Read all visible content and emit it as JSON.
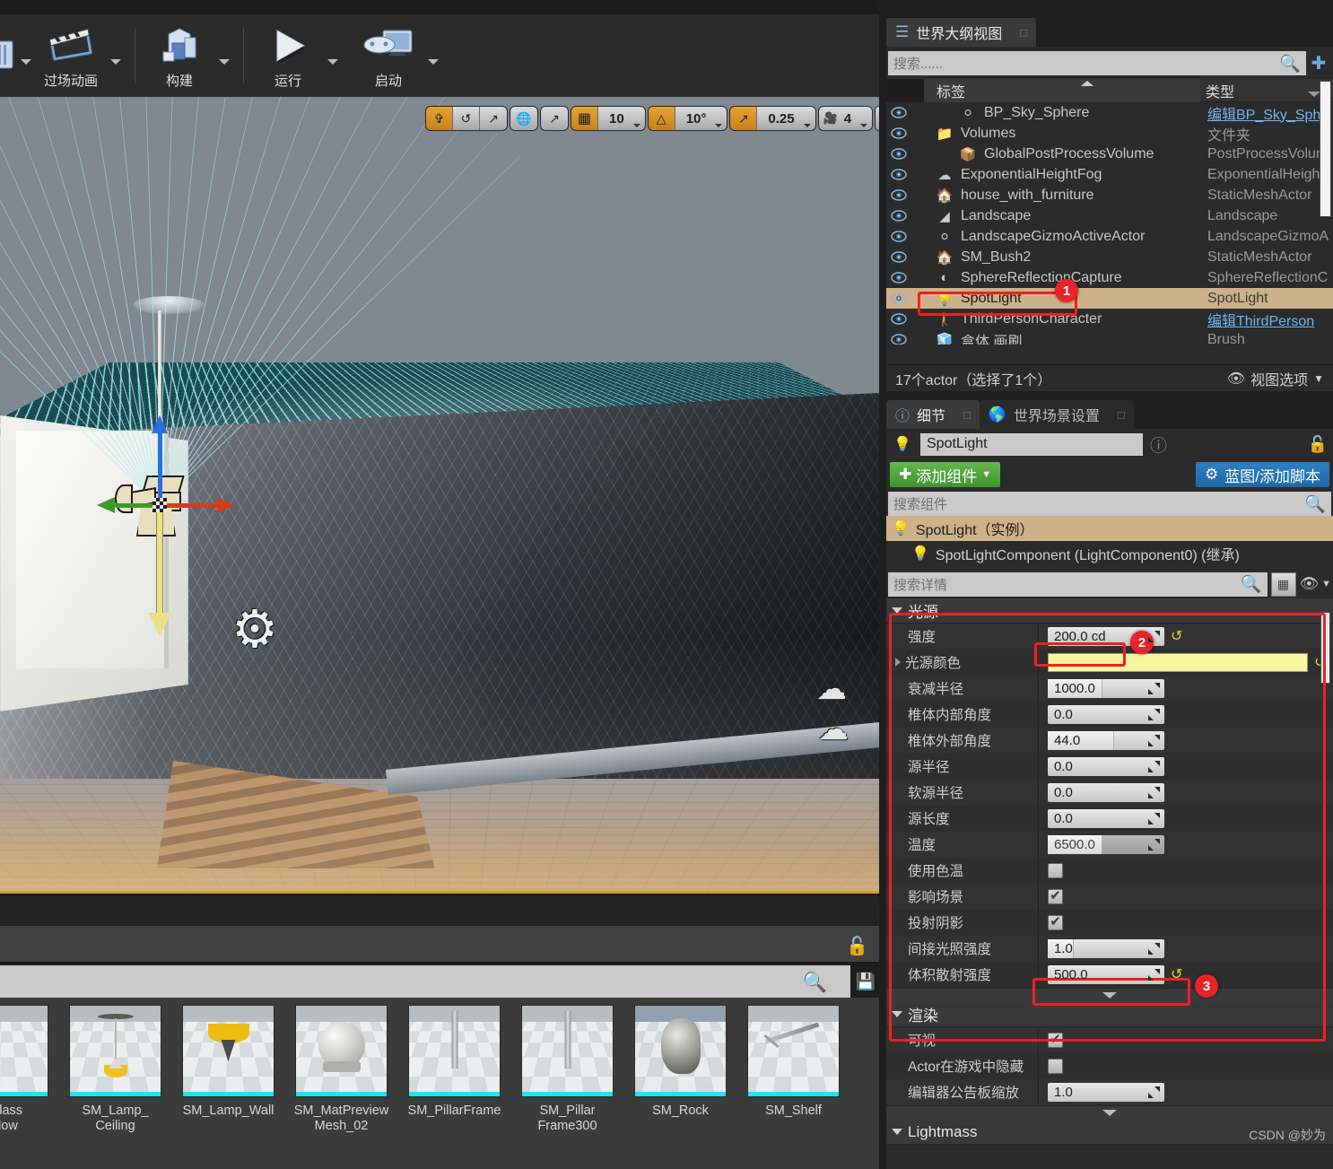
{
  "toolbar": {
    "items": [
      {
        "label": "过场动画",
        "icon": "clapperboard-icon",
        "has_caret": true
      },
      {
        "label": "构建",
        "icon": "build-icon",
        "has_caret": true
      },
      {
        "label": "运行",
        "icon": "play-icon",
        "has_caret": true
      },
      {
        "label": "启动",
        "icon": "launch-icon",
        "has_caret": true
      }
    ]
  },
  "viewport": {
    "toolbar": {
      "transform_modes": [
        {
          "name": "translate-mode",
          "glyph": "✥",
          "active": true
        },
        {
          "name": "rotate-mode",
          "glyph": "⟳",
          "active": false
        },
        {
          "name": "scale-mode",
          "glyph": "⤢",
          "active": false
        }
      ],
      "coord_mode": {
        "name": "world-coordinate-toggle",
        "glyph": "🌐",
        "active": false
      },
      "surface_snap": {
        "name": "surface-snap-toggle",
        "glyph": "⇱",
        "active": false
      },
      "grid_snap": {
        "name": "grid-snap-toggle",
        "active": true
      },
      "grid_size": "10",
      "angle_snap": {
        "name": "angle-snap-toggle",
        "active": true
      },
      "angle_size": "10°",
      "scale_snap": {
        "name": "scale-snap-toggle",
        "active": true
      },
      "scale_size": "0.25",
      "camera_speed": "4",
      "maximize": {
        "name": "maximize-viewport-button",
        "glyph": "❐"
      }
    }
  },
  "outliner": {
    "tab_title": "世界大纲视图",
    "search_placeholder": "搜索......",
    "add_button_title": "+",
    "columns": {
      "label": "标签",
      "type": "类型"
    },
    "rows": [
      {
        "label": "BP_Sky_Sphere",
        "type": "编辑BP_Sky_Sph",
        "indent": 2,
        "icon": "sphere-icon",
        "type_is_link": true,
        "selected": false
      },
      {
        "label": "Volumes",
        "type": "文件夹",
        "indent": 1,
        "icon": "folder-icon",
        "type_is_link": false,
        "selected": false
      },
      {
        "label": "GlobalPostProcessVolume",
        "type": "PostProcessVolum",
        "indent": 2,
        "icon": "volume-icon",
        "type_is_link": false,
        "selected": false
      },
      {
        "label": "ExponentialHeightFog",
        "type": "ExponentialHeightl",
        "indent": 1,
        "icon": "fog-icon",
        "type_is_link": false,
        "selected": false
      },
      {
        "label": "house_with_furniture",
        "type": "StaticMeshActor",
        "indent": 1,
        "icon": "mesh-icon",
        "type_is_link": false,
        "selected": false
      },
      {
        "label": "Landscape",
        "type": "Landscape",
        "indent": 1,
        "icon": "landscape-icon",
        "type_is_link": false,
        "selected": false
      },
      {
        "label": "LandscapeGizmoActiveActor",
        "type": "LandscapeGizmoA",
        "indent": 1,
        "icon": "gizmo-icon",
        "type_is_link": false,
        "selected": false
      },
      {
        "label": "SM_Bush2",
        "type": "StaticMeshActor",
        "indent": 1,
        "icon": "mesh-icon",
        "type_is_link": false,
        "selected": false
      },
      {
        "label": "SphereReflectionCapture",
        "type": "SphereReflectionC",
        "indent": 1,
        "icon": "reflection-icon",
        "type_is_link": false,
        "selected": false
      },
      {
        "label": "SpotLight",
        "type": "SpotLight",
        "indent": 1,
        "icon": "spotlight-icon",
        "type_is_link": false,
        "selected": true
      },
      {
        "label": "ThirdPersonCharacter",
        "type": "编辑ThirdPerson",
        "indent": 1,
        "icon": "character-icon",
        "type_is_link": true,
        "selected": false
      },
      {
        "label": "盒体 画刷",
        "type": "Brush",
        "indent": 1,
        "icon": "brush-icon",
        "type_is_link": false,
        "selected": false
      }
    ],
    "footer_count": "17个actor（选择了1个）",
    "view_options": "视图选项"
  },
  "details": {
    "tabs": [
      {
        "label": "细节",
        "icon": "info-icon",
        "active": true
      },
      {
        "label": "世界场景设置",
        "icon": "globe-icon",
        "active": false
      }
    ],
    "actor_name": "SpotLight",
    "add_component_label": "添加组件",
    "blueprint_label": "蓝图/添加脚本",
    "component_search_placeholder": "搜索组件",
    "components": [
      {
        "label": "SpotLight（实例）",
        "selected": true,
        "child": false
      },
      {
        "label": "SpotLightComponent (LightComponent0) (继承)",
        "selected": false,
        "child": true
      }
    ],
    "details_search_placeholder": "搜索详情",
    "sections": [
      {
        "title": "光源",
        "rows": [
          {
            "label": "强度",
            "kind": "number",
            "value": "200.0 cd",
            "fill": 0,
            "revert": true,
            "highlight": true
          },
          {
            "label": "光源颜色",
            "kind": "color",
            "value": "#f9f59e",
            "revert": true,
            "expandable": true
          },
          {
            "label": "衰减半径",
            "kind": "number",
            "value": "1000.0",
            "fill": 47,
            "revert": false
          },
          {
            "label": "椎体内部角度",
            "kind": "number",
            "value": "0.0",
            "fill": 0,
            "revert": false
          },
          {
            "label": "椎体外部角度",
            "kind": "number",
            "value": "44.0",
            "fill": 57,
            "revert": false
          },
          {
            "label": "源半径",
            "kind": "number",
            "value": "0.0",
            "fill": 0,
            "revert": false
          },
          {
            "label": "软源半径",
            "kind": "number",
            "value": "0.0",
            "fill": 0,
            "revert": false
          },
          {
            "label": "源长度",
            "kind": "number",
            "value": "0.0",
            "fill": 0,
            "revert": false
          },
          {
            "label": "温度",
            "kind": "number-dim",
            "value": "6500.0",
            "fill": 47,
            "revert": false
          },
          {
            "label": "使用色温",
            "kind": "checkbox",
            "checked": false
          },
          {
            "label": "影响场景",
            "kind": "checkbox",
            "checked": true
          },
          {
            "label": "投射阴影",
            "kind": "checkbox",
            "checked": true
          },
          {
            "label": "间接光照强度",
            "kind": "number",
            "value": "1.0",
            "fill": 22,
            "revert": false
          },
          {
            "label": "体积散射强度",
            "kind": "number",
            "value": "500.0",
            "fill": 0,
            "revert": true,
            "highlight": true
          }
        ]
      },
      {
        "title": "渲染",
        "rows": [
          {
            "label": "可视",
            "kind": "checkbox",
            "checked": true
          },
          {
            "label": "Actor在游戏中隐藏",
            "kind": "checkbox",
            "checked": false
          },
          {
            "label": "编辑器公告板缩放",
            "kind": "number",
            "value": "1.0",
            "fill": 0,
            "revert": false
          }
        ]
      },
      {
        "title": "Lightmass",
        "rows": []
      }
    ]
  },
  "content_browser": {
    "search_placeholder": "",
    "items": [
      {
        "name": "_Glass\nndow",
        "thumb": "glass-window-thumb"
      },
      {
        "name": "SM_Lamp_\nCeiling",
        "thumb": "lamp-ceiling-thumb"
      },
      {
        "name": "SM_Lamp_Wall",
        "thumb": "lamp-wall-thumb"
      },
      {
        "name": "SM_MatPreview\nMesh_02",
        "thumb": "matpreview-mesh-thumb"
      },
      {
        "name": "SM_PillarFrame",
        "thumb": "pillar-frame-thumb"
      },
      {
        "name": "SM_Pillar\nFrame300",
        "thumb": "pillar-frame300-thumb"
      },
      {
        "name": "SM_Rock",
        "thumb": "rock-thumb"
      },
      {
        "name": "SM_Shelf",
        "thumb": "shelf-thumb"
      }
    ]
  },
  "annotations": [
    {
      "number": "1",
      "target": "outliner-spotlight-row"
    },
    {
      "number": "2",
      "target": "intensity-field"
    },
    {
      "number": "3",
      "target": "volumetric-scattering-field"
    }
  ],
  "watermark": "CSDN @妙为",
  "colors": {
    "accent_orange": "#d19a28",
    "selection_tan": "#cdb189",
    "link_blue": "#6fb3ef",
    "annotation_red": "#e8232a",
    "light_color": "#f9f59e",
    "thumb_bar_cyan": "#19e6f0"
  }
}
